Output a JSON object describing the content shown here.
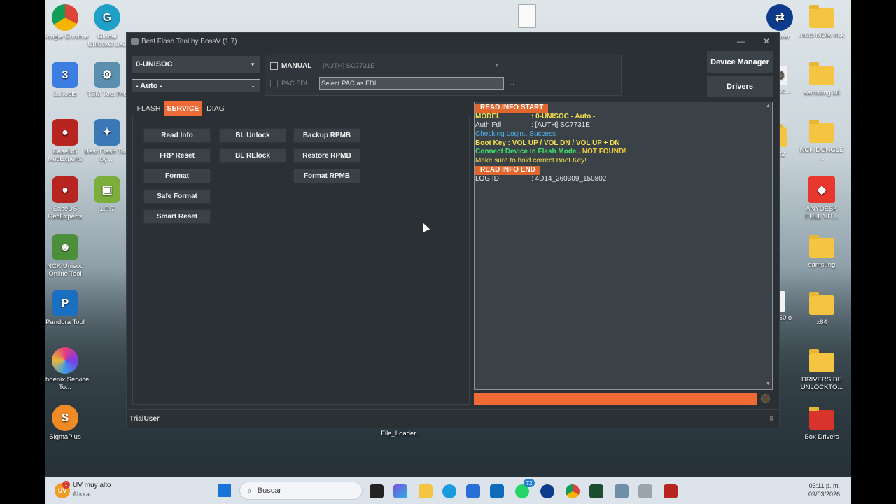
{
  "desktop": {
    "left_icons": [
      {
        "label": "Google Chrome"
      },
      {
        "label": "Global Unlocker.exe"
      },
      {
        "label": "3uTools"
      },
      {
        "label": "TSM Tool Pro"
      },
      {
        "label": "EaseUS RecExperts"
      },
      {
        "label": "Best Flash Tool by ..."
      },
      {
        "label": "EaseUS RecExperts"
      },
      {
        "label": "1.9.7"
      },
      {
        "label": "NCK Unisoc Online Tool"
      },
      {
        "label": "Pandora Tool"
      },
      {
        "label": "Phoenix Service To..."
      },
      {
        "label": "SigmaPlus"
      }
    ],
    "right_icons": [
      {
        "label": "Viewer"
      },
      {
        "label": "moto MDM mtk"
      },
      {
        "label": "e_rec..."
      },
      {
        "label": "samsung 16"
      },
      {
        "label": "g22"
      },
      {
        "label": "NCK DONGLE ..."
      },
      {
        "label": "ANYDESK FULL VIT..."
      },
      {
        "label": "samsung"
      },
      {
        "label": "hot 50 o"
      },
      {
        "label": "x64"
      },
      {
        "label": "DRIVERS DE UNLOCKTO..."
      },
      {
        "label": "Box Drivers"
      }
    ],
    "center_icon": {
      "label": "File_Loader..."
    }
  },
  "window": {
    "title": "Best Flash Tool by BossV (1.7)",
    "minimize": "—",
    "close": "✕",
    "platform_select": "0-UNISOC",
    "mode_select": "- Auto -",
    "manual_label": "MANUAL",
    "auth_select": "[AUTH] SC7731E",
    "pac_fdl_label": "PAC FDL",
    "pac_placeholder": "Select PAC as FDL",
    "browse": "...",
    "device_manager": "Device Manager",
    "drivers": "Drivers",
    "tabs": [
      {
        "label": "FLASH"
      },
      {
        "label": "SERVICE"
      },
      {
        "label": "DIAG"
      }
    ],
    "service_buttons": {
      "read_info": "Read Info",
      "frp_reset": "FRP Reset",
      "format": "Format",
      "safe_format": "Safe Format",
      "smart_reset": "Smart Reset",
      "bl_unlock": "BL Unlock",
      "bl_relock": "BL RElock",
      "backup_rpmb": "Backup RPMB",
      "restore_rpmb": "Restore RPMB",
      "format_rpmb": "Format RPMB"
    },
    "log": {
      "start": "READ INFO START",
      "model_label": "MODEL",
      "model_value": ": 0-UNISOC - Auto -",
      "authfdl_label": "Auth Fdl",
      "authfdl_value": ": [AUTH] SC7731E",
      "login": "Checking Login.. Success",
      "bootkey": "Boot Key : VOL UP / VOL DN / VOL UP + DN",
      "connect": "Connect Device in Flash Mode..",
      "notfound": "NOT FOUND!",
      "hold": "Make sure to hold correct Boot Key!",
      "end": "READ INFO END",
      "logid_label": "LOG ID",
      "logid_value": ": 4D14_260309_150802"
    },
    "progress_percent": 100,
    "status_user": "TrialUser"
  },
  "taskbar": {
    "weather_title": "UV muy alto",
    "weather_sub": "Ahora",
    "weather_badge": "1",
    "search_placeholder": "Buscar",
    "whatsapp_badge": "72",
    "time": "03:11 p. m.",
    "date": "09/03/2026"
  },
  "colors": {
    "accent": "#ef6a35",
    "window_bg": "#2b3035",
    "log_bg": "#3a4147"
  }
}
